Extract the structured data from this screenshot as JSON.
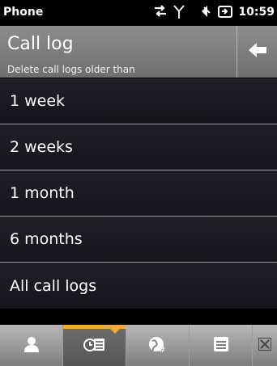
{
  "status_bar": {
    "app_name": "Phone",
    "time": "10:59",
    "icons": [
      "data-transfer-icon",
      "signal-icon",
      "speaker-muted-icon",
      "battery-charging-icon"
    ]
  },
  "header": {
    "title": "Call log",
    "subtitle": "Delete call logs older than",
    "back_icon": "back-arrow-icon"
  },
  "options": [
    {
      "label": "1 week"
    },
    {
      "label": "2 weeks"
    },
    {
      "label": "1 month"
    },
    {
      "label": "6 months"
    },
    {
      "label": "All call logs"
    }
  ],
  "toolbar": {
    "items": [
      {
        "icon": "contacts-icon",
        "active": false
      },
      {
        "icon": "call-history-icon",
        "active": true
      },
      {
        "icon": "dialpad-globe-icon",
        "active": false
      },
      {
        "icon": "menu-icon",
        "active": false
      }
    ],
    "close_icon": "close-icon"
  },
  "colors": {
    "accent": "#f0a93b",
    "list_background": "#1a1a22",
    "header_background": "#7d7d7d"
  }
}
